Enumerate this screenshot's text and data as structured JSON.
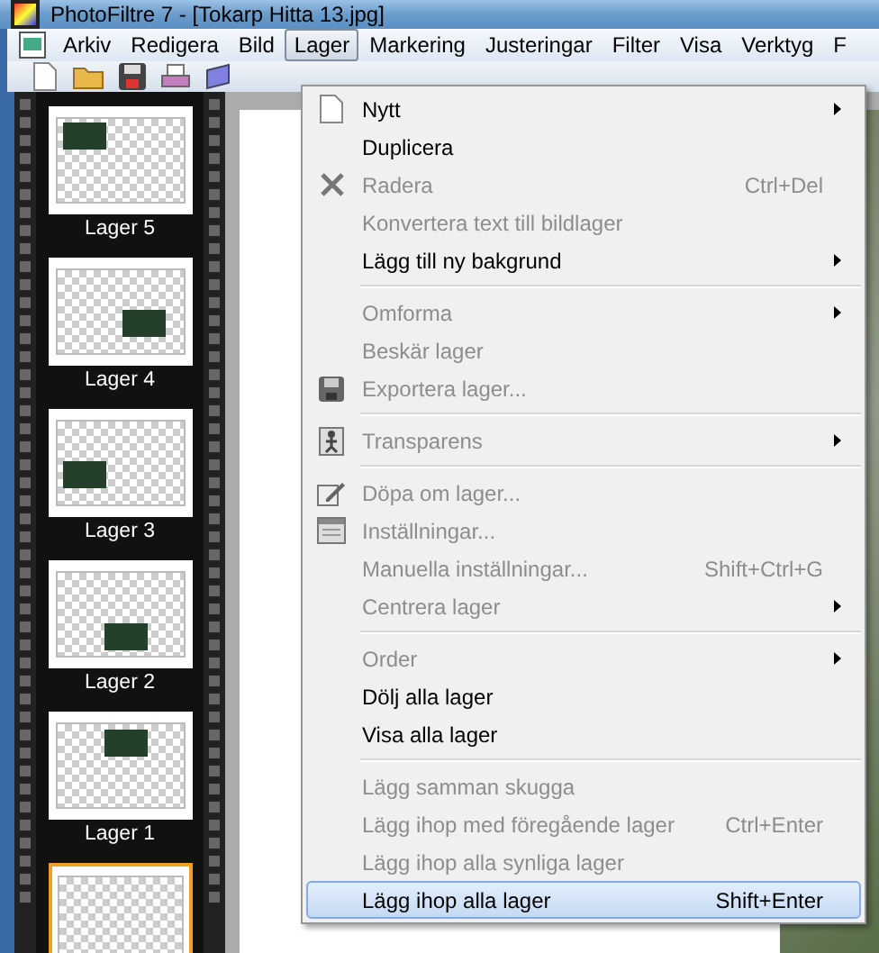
{
  "window": {
    "title": "PhotoFiltre 7 - [Tokarp Hitta 13.jpg]"
  },
  "menubar": [
    {
      "label": "Arkiv",
      "selected": false
    },
    {
      "label": "Redigera",
      "selected": false
    },
    {
      "label": "Bild",
      "selected": false
    },
    {
      "label": "Lager",
      "selected": true
    },
    {
      "label": "Markering",
      "selected": false
    },
    {
      "label": "Justeringar",
      "selected": false
    },
    {
      "label": "Filter",
      "selected": false
    },
    {
      "label": "Visa",
      "selected": false
    },
    {
      "label": "Verktyg",
      "selected": false
    },
    {
      "label": "F",
      "selected": false
    }
  ],
  "layers": [
    {
      "name": "Lager 5",
      "selected": false
    },
    {
      "name": "Lager 4",
      "selected": false
    },
    {
      "name": "Lager 3",
      "selected": false
    },
    {
      "name": "Lager 2",
      "selected": false
    },
    {
      "name": "Lager 1",
      "selected": false
    },
    {
      "selected": true
    }
  ],
  "menu": [
    {
      "kind": "item",
      "label": "Nytt",
      "disabled": false,
      "submenu": true,
      "selected": false
    },
    {
      "kind": "item",
      "label": "Duplicera",
      "disabled": false,
      "submenu": false,
      "selected": false
    },
    {
      "kind": "item",
      "label": "Radera",
      "shortcut": "Ctrl+Del",
      "disabled": true,
      "submenu": false,
      "selected": false
    },
    {
      "kind": "item",
      "label": "Konvertera text till bildlager",
      "disabled": true,
      "submenu": false,
      "selected": false
    },
    {
      "kind": "item",
      "label": "Lägg till ny bakgrund",
      "disabled": false,
      "submenu": true,
      "selected": false
    },
    {
      "kind": "separator"
    },
    {
      "kind": "item",
      "label": "Omforma",
      "disabled": true,
      "submenu": true,
      "selected": false
    },
    {
      "kind": "item",
      "label": "Beskär lager",
      "disabled": true,
      "submenu": false,
      "selected": false
    },
    {
      "kind": "item",
      "label": "Exportera lager...",
      "disabled": true,
      "submenu": false,
      "selected": false
    },
    {
      "kind": "separator"
    },
    {
      "kind": "item",
      "label": "Transparens",
      "disabled": true,
      "submenu": true,
      "selected": false
    },
    {
      "kind": "separator"
    },
    {
      "kind": "item",
      "label": "Döpa om lager...",
      "disabled": true,
      "submenu": false,
      "selected": false
    },
    {
      "kind": "item",
      "label": "Inställningar...",
      "disabled": true,
      "submenu": false,
      "selected": false
    },
    {
      "kind": "item",
      "label": "Manuella inställningar...",
      "shortcut": "Shift+Ctrl+G",
      "disabled": true,
      "submenu": false,
      "selected": false
    },
    {
      "kind": "item",
      "label": "Centrera lager",
      "disabled": true,
      "submenu": true,
      "selected": false
    },
    {
      "kind": "separator"
    },
    {
      "kind": "item",
      "label": "Order",
      "disabled": true,
      "submenu": true,
      "selected": false
    },
    {
      "kind": "item",
      "label": "Dölj alla lager",
      "disabled": false,
      "submenu": false,
      "selected": false
    },
    {
      "kind": "item",
      "label": "Visa alla lager",
      "disabled": false,
      "submenu": false,
      "selected": false
    },
    {
      "kind": "separator"
    },
    {
      "kind": "item",
      "label": "Lägg samman skugga",
      "disabled": true,
      "submenu": false,
      "selected": false
    },
    {
      "kind": "item",
      "label": "Lägg ihop med föregående lager",
      "shortcut": "Ctrl+Enter",
      "disabled": true,
      "submenu": false,
      "selected": false
    },
    {
      "kind": "item",
      "label": "Lägg ihop alla synliga lager",
      "disabled": true,
      "submenu": false,
      "selected": false
    },
    {
      "kind": "item",
      "label": "Lägg ihop alla lager",
      "shortcut": "Shift+Enter",
      "disabled": false,
      "submenu": false,
      "selected": true
    }
  ]
}
